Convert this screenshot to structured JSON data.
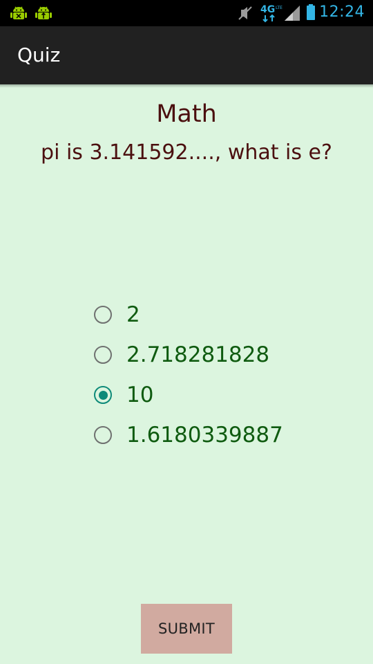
{
  "status_bar": {
    "notifications": [
      "android-debug-icon",
      "android-usb-icon"
    ],
    "indicators": [
      "mute-icon",
      "4g-lte-icon",
      "signal-icon",
      "battery-icon"
    ],
    "network_label": "4G",
    "time": "12:24",
    "time_color": "#33b5e5"
  },
  "action_bar": {
    "title": "Quiz"
  },
  "quiz": {
    "category": "Math",
    "question": "pi is 3.141592...., what is e?",
    "options": [
      {
        "label": "2",
        "checked": false
      },
      {
        "label": "2.718281828",
        "checked": false
      },
      {
        "label": "10",
        "checked": true
      },
      {
        "label": "1.6180339887",
        "checked": false
      }
    ]
  },
  "submit": {
    "label": "SUBMIT"
  },
  "colors": {
    "background": "#dcf5df",
    "question_text": "#4b0f0f",
    "option_text": "#0f5b10",
    "radio_checked": "#0d8a79",
    "submit_background": "#d1aaa0"
  }
}
